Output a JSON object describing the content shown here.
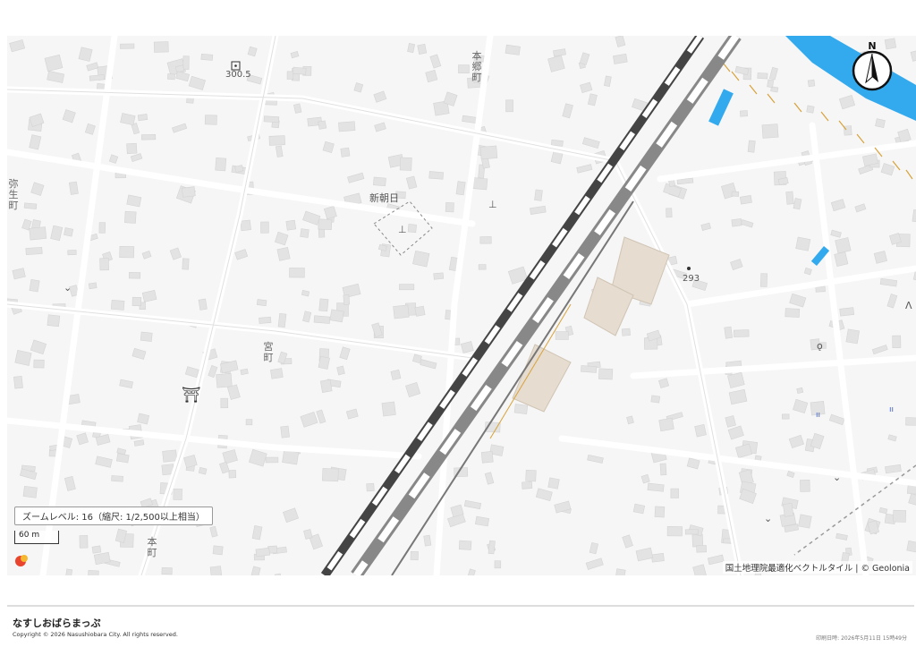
{
  "map": {
    "labels": {
      "hongo": "本郷町",
      "yayoi": "弥生町",
      "shinasahi": "新朝日",
      "miya": "宮町",
      "hon": "本町",
      "elev_300": "300.5",
      "elev_293": "293"
    },
    "zoom_text": "ズームレベル: 16（縮尺: 1/2,500以上相当）",
    "scale_text": "60 m",
    "attribution": "国土地理院最適化ベクトルタイル | © Geolonia",
    "compass_letter": "N"
  },
  "footer": {
    "title": "なすしおばらまっぷ",
    "copyright": "Copyright © 2026 Nasushiobara City. All rights reserved.",
    "print_date": "印刷日時: 2026年5月11日 15時49分"
  },
  "colors": {
    "water": "#33aaee",
    "rail": "#555555",
    "background": "#f6f6f6",
    "building": "#e2e2e2"
  }
}
